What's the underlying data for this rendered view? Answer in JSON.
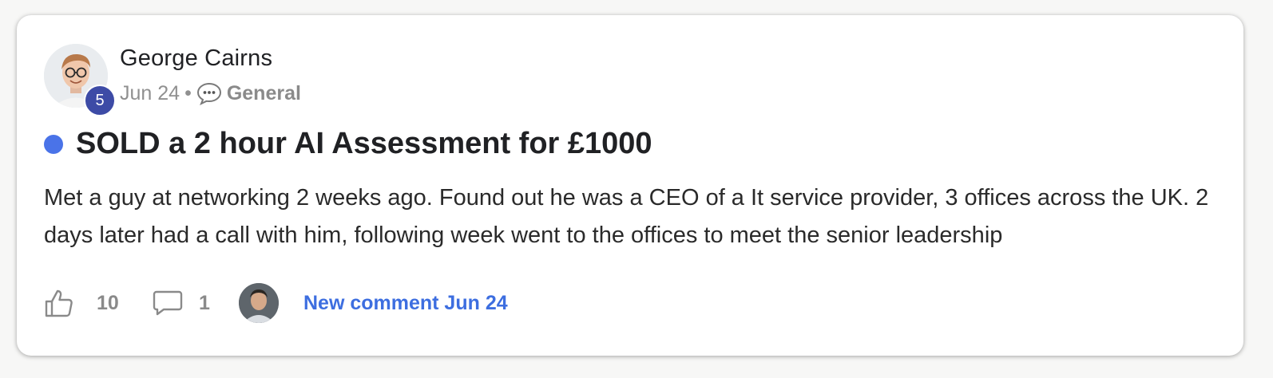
{
  "post": {
    "author": {
      "name": "George Cairns",
      "level": "5"
    },
    "date": "Jun 24",
    "separator": "•",
    "category": "General",
    "title": "SOLD a 2 hour AI Assessment for £1000",
    "body": "Met a guy at networking 2 weeks ago. Found out he was a CEO of a It service provider, 3 offices across the UK. 2 days later had a call with him, following week went to the offices to meet the senior leadership",
    "likes": "10",
    "comments": "1",
    "new_comment": "New comment Jun 24"
  },
  "icons": {
    "category": "speech-bubble-icon",
    "like": "thumbs-up-icon",
    "comment": "comment-icon"
  },
  "colors": {
    "accent": "#3d6ee0",
    "unread_dot": "#4a73e8",
    "level_badge": "#3d4ba6"
  }
}
